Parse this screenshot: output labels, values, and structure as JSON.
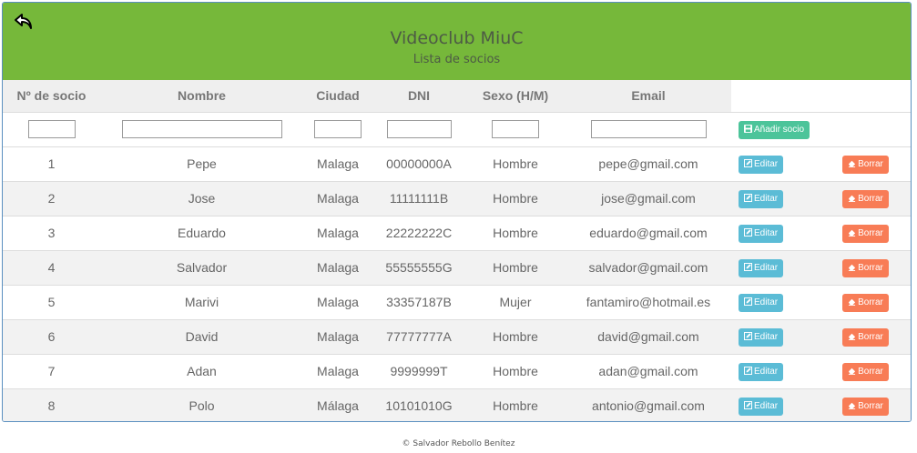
{
  "header": {
    "title": "Videoclub MiuC",
    "subtitle": "Lista de socios"
  },
  "table": {
    "columns": [
      "Nº de socio",
      "Nombre",
      "Ciudad",
      "DNI",
      "Sexo (H/M)",
      "Email"
    ],
    "add_label": "Añadir socio",
    "edit_label": "Editar",
    "delete_label": "Borrar",
    "rows": [
      {
        "id": "1",
        "name": "Pepe",
        "city": "Malaga",
        "dni": "00000000A",
        "sex": "Hombre",
        "email": "pepe@gmail.com"
      },
      {
        "id": "2",
        "name": "Jose",
        "city": "Malaga",
        "dni": "11111111B",
        "sex": "Hombre",
        "email": "jose@gmail.com"
      },
      {
        "id": "3",
        "name": "Eduardo",
        "city": "Malaga",
        "dni": "22222222C",
        "sex": "Hombre",
        "email": "eduardo@gmail.com"
      },
      {
        "id": "4",
        "name": "Salvador",
        "city": "Malaga",
        "dni": "55555555G",
        "sex": "Hombre",
        "email": "salvador@gmail.com"
      },
      {
        "id": "5",
        "name": "Marivi",
        "city": "Malaga",
        "dni": "33357187B",
        "sex": "Mujer",
        "email": "fantamiro@hotmail.es"
      },
      {
        "id": "6",
        "name": "David",
        "city": "Malaga",
        "dni": "77777777A",
        "sex": "Hombre",
        "email": "david@gmail.com"
      },
      {
        "id": "7",
        "name": "Adan",
        "city": "Malaga",
        "dni": "9999999T",
        "sex": "Hombre",
        "email": "adan@gmail.com"
      },
      {
        "id": "8",
        "name": "Polo",
        "city": "Málaga",
        "dni": "10101010G",
        "sex": "Hombre",
        "email": "antonio@gmail.com"
      }
    ]
  },
  "footer": {
    "text": "© Salvador Rebollo Benítez"
  },
  "colors": {
    "header_bg": "#76b83a",
    "add_button": "#4cc49a",
    "edit_button": "#5bbcd6",
    "delete_button": "#f87c56"
  }
}
